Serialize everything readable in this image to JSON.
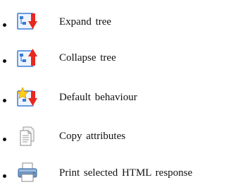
{
  "items": [
    {
      "label": "Expand tree",
      "icon": "expand-tree-icon"
    },
    {
      "label": "Collapse tree",
      "icon": "collapse-tree-icon"
    },
    {
      "label": "Default behaviour",
      "icon": "default-behaviour-icon"
    },
    {
      "label": "Copy attributes",
      "icon": "copy-attributes-icon"
    },
    {
      "label": "Print selected HTML response",
      "icon": "printer-icon"
    }
  ],
  "colors": {
    "tree_icon_blue": "#3a7bd5",
    "arrow_red": "#e8281f",
    "star_yellow": "#ffcc1a",
    "printer_blue": "#4a7fb8",
    "document_gray": "#9a9a9a"
  }
}
